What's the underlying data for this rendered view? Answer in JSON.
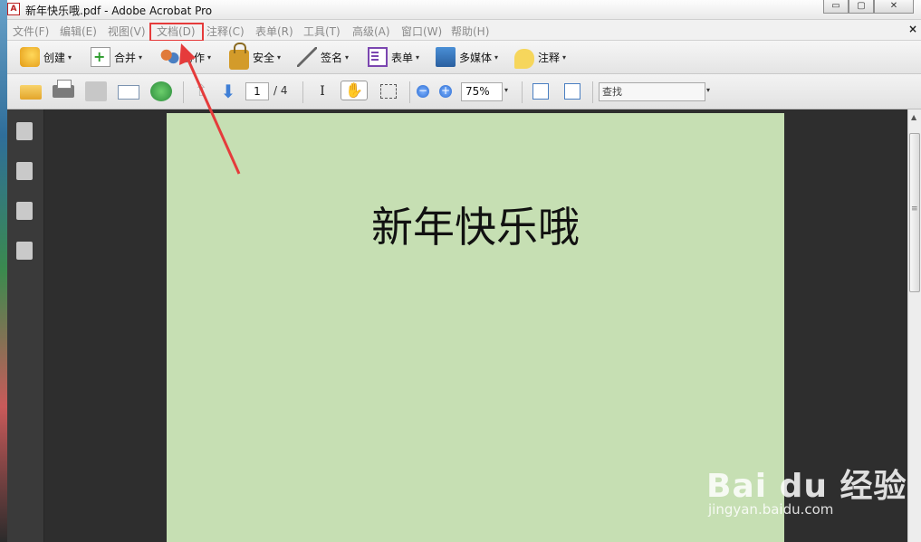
{
  "window": {
    "title": "新年快乐哦.pdf - Adobe Acrobat Pro",
    "min_label": "▭",
    "max_label": "▢",
    "close_label": "✕"
  },
  "menubar": {
    "items": [
      {
        "label": "文件(F)"
      },
      {
        "label": "编辑(E)"
      },
      {
        "label": "视图(V)"
      },
      {
        "label": "文档(D)"
      },
      {
        "label": "注释(C)"
      },
      {
        "label": "表单(R)"
      },
      {
        "label": "工具(T)"
      },
      {
        "label": "高级(A)"
      },
      {
        "label": "窗口(W)"
      },
      {
        "label": "帮助(H)"
      }
    ],
    "doc_close": "×"
  },
  "toolbar1": {
    "create": "创建",
    "combine": "合并",
    "collaborate": "协作",
    "secure": "安全",
    "sign": "签名",
    "forms": "表单",
    "multimedia": "多媒体",
    "comment": "注释",
    "dropdown_glyph": "▾"
  },
  "toolbar2": {
    "page_current": "1",
    "page_total": "/ 4",
    "zoom": "75%",
    "find_placeholder": "查找",
    "up_glyph": "⇧",
    "down_glyph": "⬇",
    "cursor_glyph": "I",
    "hand_glyph": "✋",
    "zoom_out_glyph": "−",
    "zoom_in_glyph": "+",
    "dropdown_glyph": "▾"
  },
  "document": {
    "heading": "新年快乐哦"
  },
  "watermark": {
    "logo": "Bai du 经验",
    "url": "jingyan.baidu.com"
  },
  "colors": {
    "highlight": "#e53b3b",
    "page_background": "#c6dfb3"
  },
  "icons": {
    "app": "acrobat-icon",
    "nav": [
      "pages-icon",
      "bookmarks-icon",
      "layers-icon",
      "signatures-icon"
    ]
  }
}
